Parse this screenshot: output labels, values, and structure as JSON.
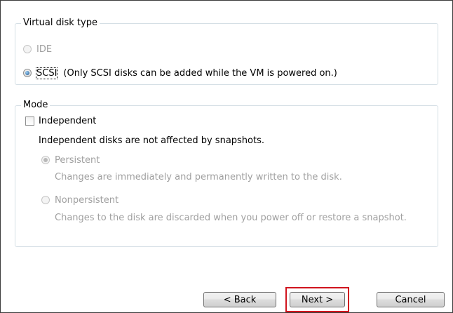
{
  "disk_type": {
    "legend": "Virtual disk type",
    "ide_label": "IDE",
    "scsi_label": "SCSI",
    "scsi_note": "(Only SCSI disks can be added while the VM is powered on.)",
    "selected": "SCSI"
  },
  "mode": {
    "legend": "Mode",
    "independent_label": "Independent",
    "independent_checked": false,
    "description": "Independent disks are not affected by snapshots.",
    "persistent_label": "Persistent",
    "persistent_desc": "Changes are immediately and permanently written to the disk.",
    "nonpersistent_label": "Nonpersistent",
    "nonpersistent_desc": "Changes to the disk are discarded when you power off or restore a snapshot."
  },
  "buttons": {
    "back": "< Back",
    "next": "Next >",
    "cancel": "Cancel"
  },
  "colors": {
    "group_border": "#d5dfe5",
    "disabled_text": "#a0a0a0",
    "highlight": "#d0141e"
  }
}
